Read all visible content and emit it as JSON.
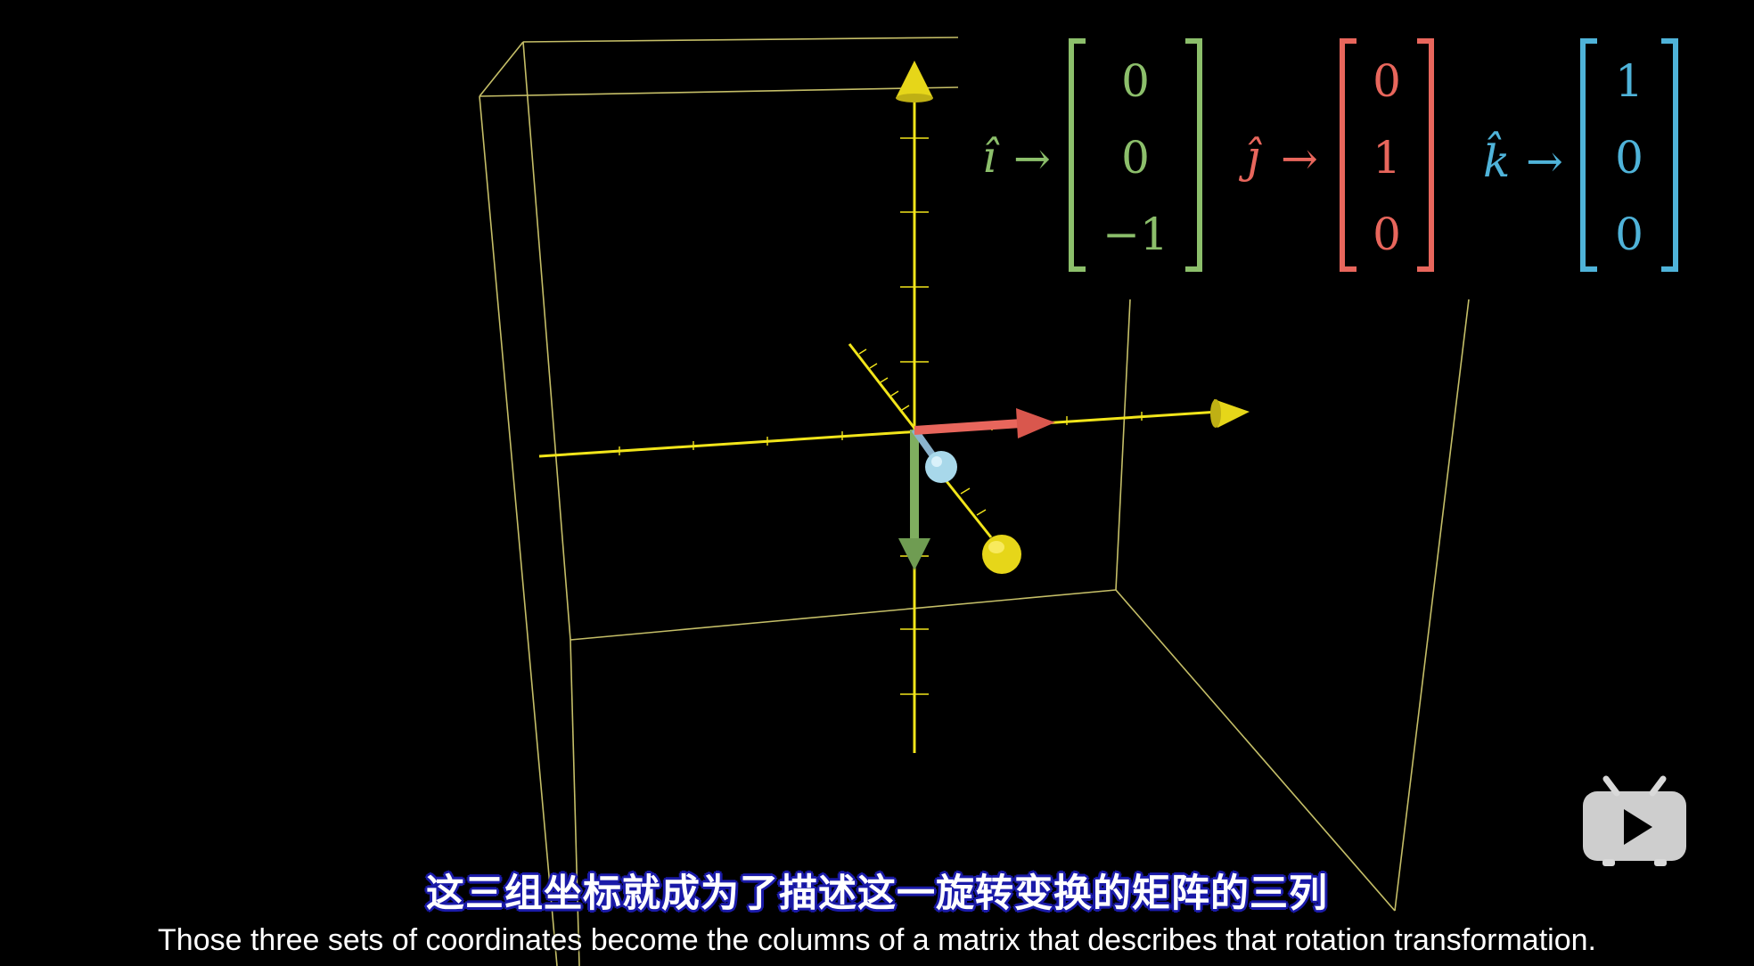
{
  "colors": {
    "i_hat": "#8cbf6b",
    "j_hat": "#e8665c",
    "k_hat": "#4fb3d9",
    "axis": "#f2e51a",
    "box": "#e8e07a",
    "background": "#000000"
  },
  "matrices": {
    "i_hat": {
      "label": "î",
      "arrow": "→",
      "entries": [
        "0",
        "0",
        "−1"
      ]
    },
    "j_hat": {
      "label": "ĵ",
      "arrow": "→",
      "entries": [
        "0",
        "1",
        "0"
      ]
    },
    "k_hat": {
      "label": "k̂",
      "arrow": "→",
      "entries": [
        "1",
        "0",
        "0"
      ]
    }
  },
  "subtitles": {
    "zh": "这三组坐标就成为了描述这一旋转变换的矩阵的三列",
    "en": "Those three sets of coordinates become the columns of a matrix that describes that rotation transformation."
  },
  "watermark": {
    "icon": "bilibili-tv-play-icon"
  }
}
